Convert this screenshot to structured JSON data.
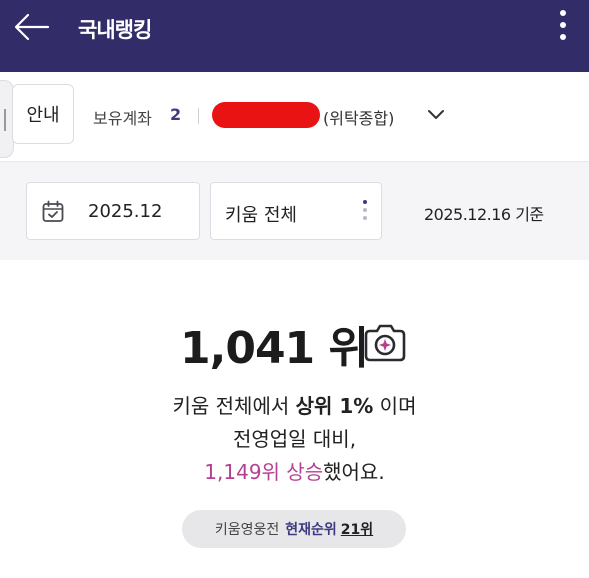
{
  "header": {
    "title": "국내랭킹",
    "back_icon": "arrow-left-icon",
    "menu_icon": "kebab-menu-icon",
    "color": "#322d68"
  },
  "account": {
    "guide_label": "안내",
    "holdings_label": "보유계좌",
    "holdings_count": "2",
    "account_type": "(위탁종합)",
    "dropdown_icon": "chevron-down-icon"
  },
  "filters": {
    "date_icon": "calendar-icon",
    "date_value": "2025.12",
    "scope_value": "키움 전체",
    "basis_text": "2025.12.16 기준"
  },
  "ranking": {
    "rank_value": "1,041 위",
    "share_icon": "camera-icon",
    "line1_pre": "키움 전체에서 ",
    "line1_bold": "상위 1%",
    "line1_post": " 이며",
    "line2": "전영업일 대비,",
    "line3_highlight": "1,149위 상승",
    "line3_post": "했어요.",
    "accent_color": "#b54091"
  },
  "competition": {
    "label": "키움영웅전",
    "current_label": "현재순위",
    "current_rank": "21위"
  }
}
